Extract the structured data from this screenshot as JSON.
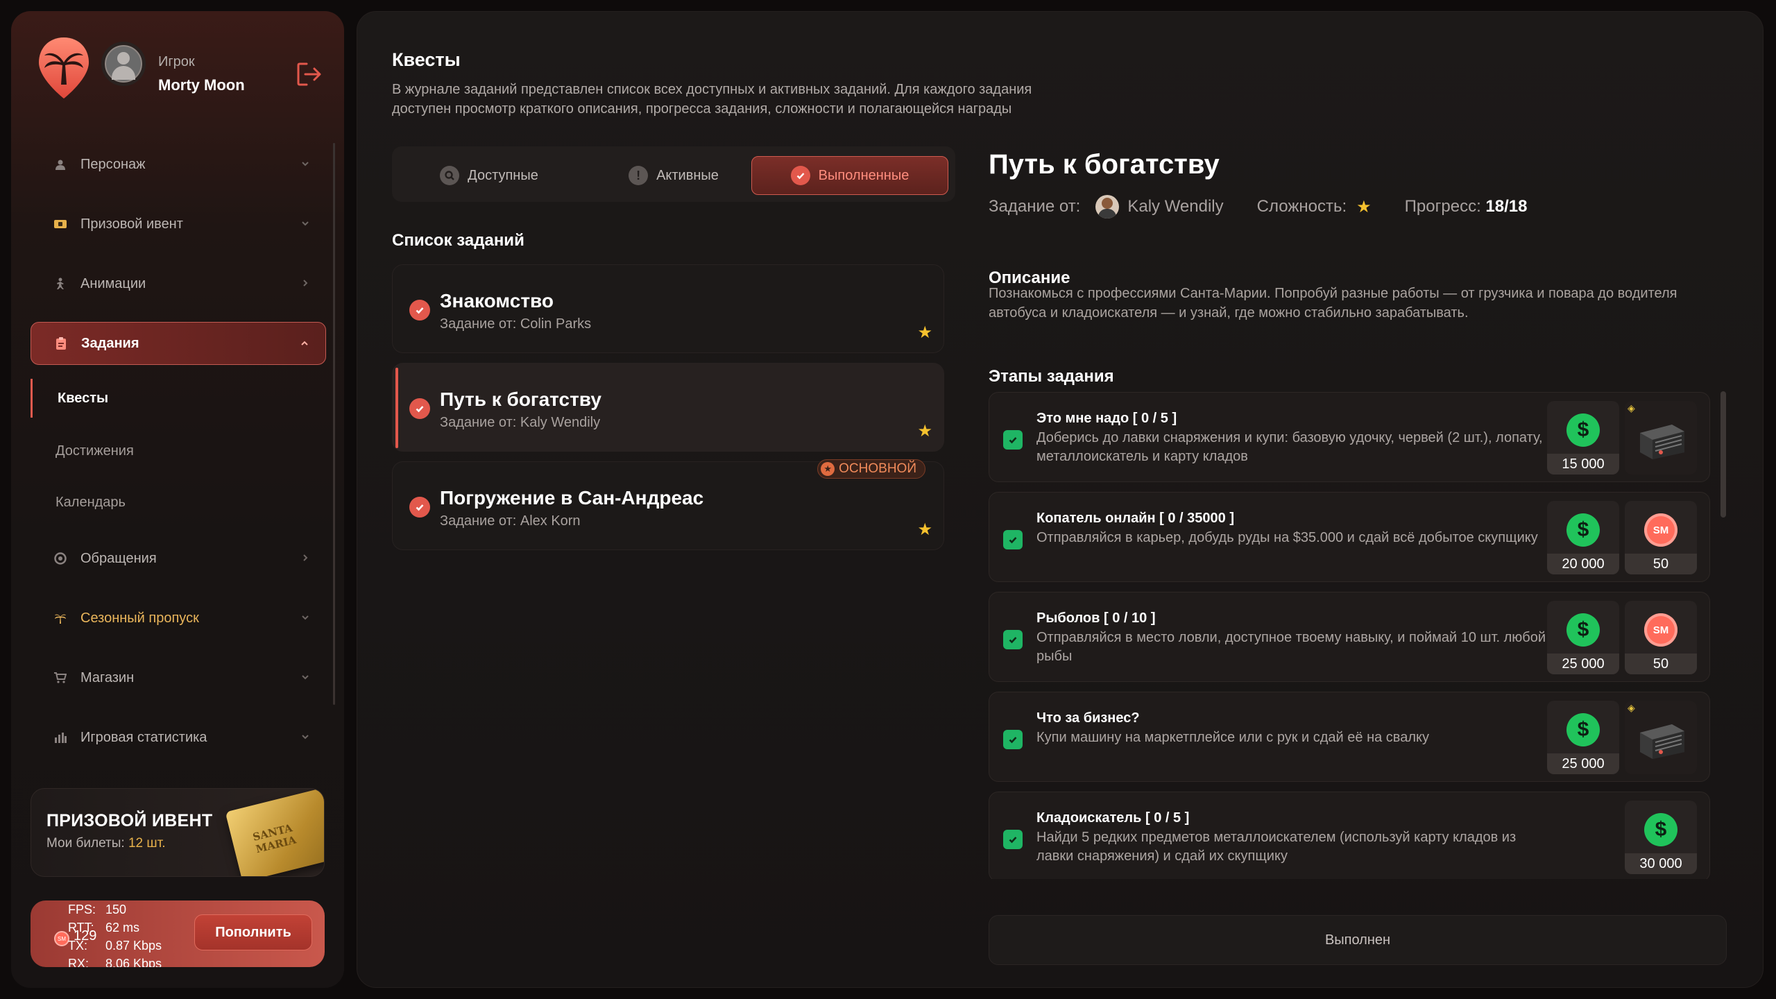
{
  "user": {
    "role": "Игрок",
    "name": "Morty Moon"
  },
  "menu": {
    "items": [
      {
        "label": "Персонаж",
        "icon": "person-icon"
      },
      {
        "label": "Призовой ивент",
        "icon": "ticket-icon"
      },
      {
        "label": "Анимации",
        "icon": "dance-icon"
      },
      {
        "label": "Задания",
        "icon": "clipboard-icon"
      },
      {
        "label": "Обращения",
        "icon": "support-icon"
      },
      {
        "label": "Сезонный пропуск",
        "icon": "palm-icon"
      },
      {
        "label": "Магазин",
        "icon": "cart-icon"
      },
      {
        "label": "Игровая статистика",
        "icon": "bar-chart-icon"
      }
    ],
    "submenu": [
      "Квесты",
      "Достижения",
      "Календарь"
    ]
  },
  "event": {
    "title": "ПРИЗОВОЙ ИВЕНТ",
    "tickets_label": "Мои билеты:",
    "tickets_value": "12 шт.",
    "ticket_text": "SANTA MARIA"
  },
  "balance": {
    "value": "129",
    "topup": "Пополнить",
    "coin": "SM"
  },
  "stats": {
    "fps_label": "FPS:",
    "fps": "150",
    "rtt_label": "RTT:",
    "rtt": "62 ms",
    "tx_label": "TX:",
    "tx": "0.87 Kbps",
    "rx_label": "RX:",
    "rx": "8.06 Kbps"
  },
  "page": {
    "title": "Квесты",
    "description": "В журнале заданий представлен список всех доступных и активных заданий. Для каждого задания доступен просмотр краткого описания, прогресса задания, сложности и полагающейся награды"
  },
  "tabs": [
    "Доступные",
    "Активные",
    "Выполненные"
  ],
  "list_title": "Список заданий",
  "quests": [
    {
      "title": "Знакомство",
      "from": "Задание от: Colin Parks"
    },
    {
      "title": "Путь к богатству",
      "from": "Задание от: Kaly Wendily"
    },
    {
      "title": "Погружение в Сан-Андреас",
      "from": "Задание от: Alex Korn",
      "badge": "ОСНОВНОЙ"
    }
  ],
  "detail": {
    "title": "Путь к богатству",
    "from_label": "Задание от:",
    "from_name": "Kaly Wendily",
    "difficulty_label": "Сложность:",
    "progress_label": "Прогресс:",
    "progress_value": "18/18",
    "desc_title": "Описание",
    "description": "Познакомься с профессиями Санта-Марии. Попробуй разные работы — от грузчика и повара до водителя автобуса и кладоискателя — и узнай, где можно стабильно зарабатывать.",
    "stages_title": "Этапы задания",
    "done_label": "Выполнен"
  },
  "stages": [
    {
      "title": "Это мне надо [ 0 / 5 ]",
      "desc": "Доберись до лавки снаряжения и купи: базовую удочку, червей (2 шт.), лопату, металлоискатель и карту кладов",
      "rewards": [
        {
          "type": "money",
          "value": "15 000"
        },
        {
          "type": "case"
        }
      ]
    },
    {
      "title": "Копатель онлайн [ 0 / 35000 ]",
      "desc": "Отправляйся в карьер, добудь руды на $35.000 и сдай всё добытое скупщику",
      "rewards": [
        {
          "type": "money",
          "value": "20 000"
        },
        {
          "type": "sm",
          "value": "50"
        }
      ]
    },
    {
      "title": "Рыболов [ 0 / 10 ]",
      "desc": "Отправляйся в место ловли, доступное твоему навыку, и поймай 10 шт. любой рыбы",
      "rewards": [
        {
          "type": "money",
          "value": "25 000"
        },
        {
          "type": "sm",
          "value": "50"
        }
      ]
    },
    {
      "title": "Что за бизнес?",
      "desc": "Купи машину на маркетплейсе или с рук и сдай её на свалку",
      "rewards": [
        {
          "type": "money",
          "value": "25 000"
        },
        {
          "type": "case"
        }
      ]
    },
    {
      "title": "Кладоискатель [ 0 / 5 ]",
      "desc": "Найди 5 редких предметов металлоискателем (используй карту кладов из лавки снаряжения) и сдай их скупщику",
      "rewards": [
        {
          "type": "money",
          "value": "30 000"
        }
      ]
    }
  ],
  "colors": {
    "accent": "#e2584c",
    "success": "#1fb564",
    "gold": "#f5c12e"
  }
}
